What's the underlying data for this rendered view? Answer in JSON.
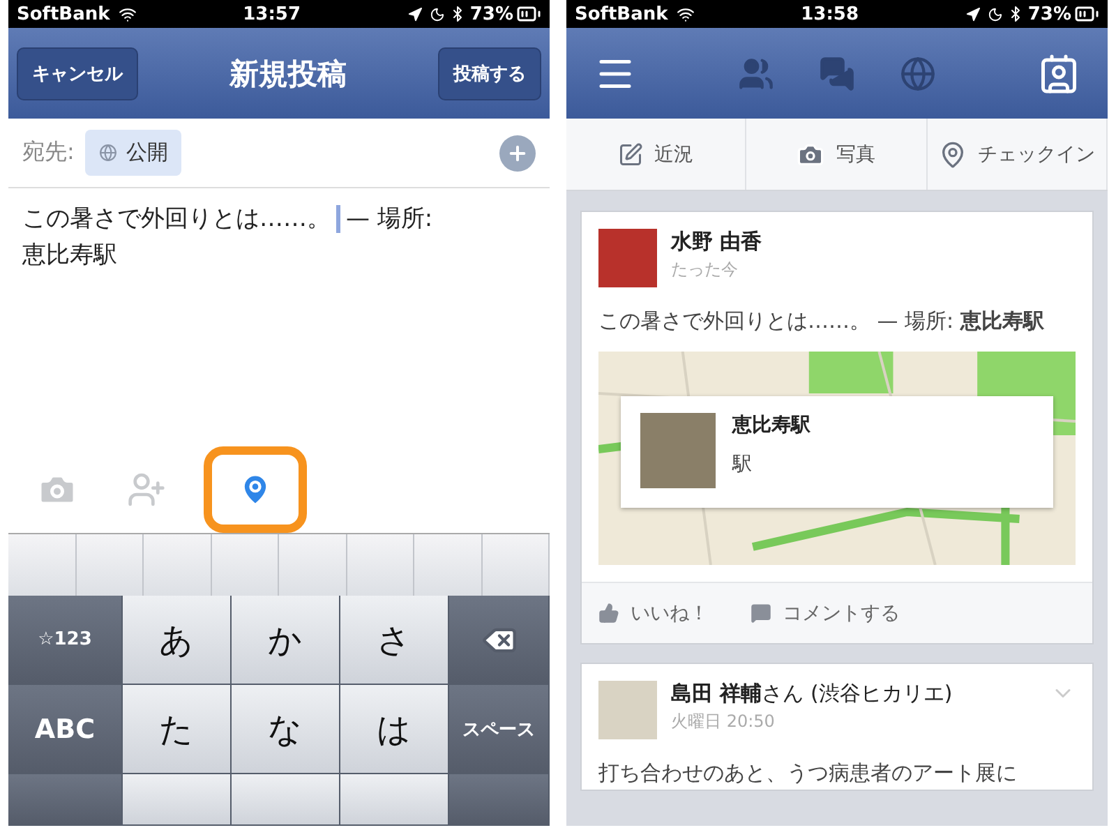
{
  "left_screen": {
    "status_bar": {
      "carrier": "SoftBank",
      "time": "13:57",
      "battery": "73%"
    },
    "nav": {
      "cancel": "キャンセル",
      "title": "新規投稿",
      "post": "投稿する"
    },
    "recipient": {
      "label": "宛先:",
      "audience": "公開"
    },
    "composer": {
      "text": "この暑さで外回りとは……。",
      "location_prefix": "— 場所:",
      "location": "恵比寿駅"
    },
    "attachments": [
      {
        "kind": "camera",
        "selected": false
      },
      {
        "kind": "tag",
        "selected": false
      },
      {
        "kind": "location",
        "selected": true
      }
    ],
    "keyboard": {
      "rows": [
        [
          {
            "kind": "function",
            "label": "☆123"
          },
          {
            "kind": "char",
            "label": "あ"
          },
          {
            "kind": "char",
            "label": "か"
          },
          {
            "kind": "char",
            "label": "さ"
          },
          {
            "kind": "delete"
          }
        ],
        [
          {
            "kind": "function",
            "label": "ABC"
          },
          {
            "kind": "char",
            "label": "た"
          },
          {
            "kind": "char",
            "label": "な"
          },
          {
            "kind": "char",
            "label": "は"
          },
          {
            "kind": "function",
            "label": "スペース"
          }
        ],
        [
          {
            "kind": "function"
          },
          {
            "kind": "char"
          },
          {
            "kind": "char"
          },
          {
            "kind": "char"
          },
          {
            "kind": "function"
          }
        ]
      ]
    }
  },
  "right_screen": {
    "status_bar": {
      "carrier": "SoftBank",
      "time": "13:58",
      "battery": "73%"
    },
    "actions": [
      {
        "kind": "status",
        "label": "近況"
      },
      {
        "kind": "photo",
        "label": "写真"
      },
      {
        "kind": "checkin",
        "label": "チェックイン"
      }
    ],
    "posts": [
      {
        "author": "**水野 由香**",
        "time": "たった今",
        "text": "この暑さで外回りとは……。 — 場所: **恵比寿駅**",
        "place": {
          "name": "恵比寿駅",
          "category": "駅"
        },
        "buttons": [
          {
            "kind": "like",
            "label": "いいね！"
          },
          {
            "kind": "comment",
            "label": "コメントする"
          }
        ]
      },
      {
        "author": "**島田 祥輔**さん (渋谷ヒカリエ)",
        "time": "火曜日 20:50",
        "text": "打ち合わせのあと、うつ病患者のアート展に"
      }
    ]
  }
}
